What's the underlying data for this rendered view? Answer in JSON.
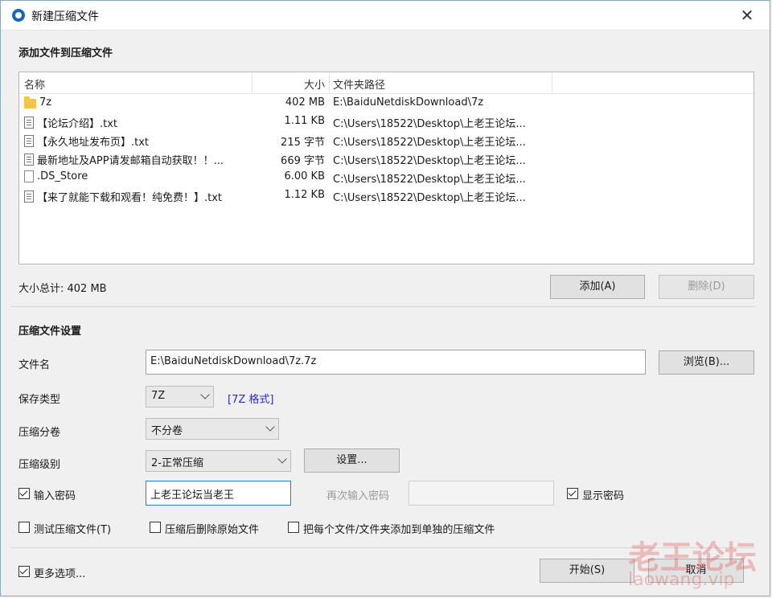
{
  "window": {
    "title": "新建压缩文件"
  },
  "add_section": {
    "title": "添加文件到压缩文件"
  },
  "file_list": {
    "columns": {
      "name": "名称",
      "size": "大小",
      "path": "文件夹路径"
    },
    "rows": [
      {
        "icon": "folder-icon",
        "name": "7z",
        "size": "402 MB",
        "path": "E:\\BaiduNetdiskDownload\\7z"
      },
      {
        "icon": "text-file-icon",
        "name": "【论坛介绍】.txt",
        "size": "1.11 KB",
        "path": "C:\\Users\\18522\\Desktop\\上老王论坛..."
      },
      {
        "icon": "text-file-icon",
        "name": "【永久地址发布页】.txt",
        "size": "215 字节",
        "path": "C:\\Users\\18522\\Desktop\\上老王论坛..."
      },
      {
        "icon": "text-file-icon",
        "name": "最新地址及APP请发邮箱自动获取！！...",
        "size": "669 字节",
        "path": "C:\\Users\\18522\\Desktop\\上老王论坛..."
      },
      {
        "icon": "blank-file-icon",
        "name": ".DS_Store",
        "size": "6.00 KB",
        "path": "C:\\Users\\18522\\Desktop\\上老王论坛..."
      },
      {
        "icon": "text-file-icon",
        "name": "【来了就能下载和观看！纯免费！】.txt",
        "size": "1.12 KB",
        "path": "C:\\Users\\18522\\Desktop\\上老王论坛..."
      }
    ]
  },
  "total_size": "大小总计: 402 MB",
  "buttons": {
    "add": "添加(A)",
    "delete": "删除(D)",
    "browse": "浏览(B)...",
    "settings": "设置...",
    "start": "开始(S)",
    "cancel": "取消"
  },
  "settings_section": {
    "title": "压缩文件设置"
  },
  "form": {
    "filename_label": "文件名",
    "filename_value": "E:\\BaiduNetdiskDownload\\7z.7z",
    "save_type_label": "保存类型",
    "save_type_value": "7Z",
    "format_note": "[7Z 格式]",
    "volume_label": "压缩分卷",
    "volume_value": "不分卷",
    "level_label": "压缩级别",
    "level_value": "2-正常压缩",
    "password_check_label": "输入密码",
    "password_value": "上老王论坛当老王",
    "repeat_password_label": "再次输入密码",
    "show_password_label": "显示密码",
    "test_label": "测试压缩文件(T)",
    "delete_after_label": "压缩后删除原始文件",
    "separate_label": "把每个文件/文件夹添加到单独的压缩文件",
    "more_options_label": "更多选项..."
  },
  "checks": {
    "password": true,
    "show_password": true,
    "test": false,
    "delete_after": false,
    "separate": false,
    "more_options": true
  },
  "watermark": {
    "cn": "老王论坛",
    "url": "laowang.vip"
  }
}
